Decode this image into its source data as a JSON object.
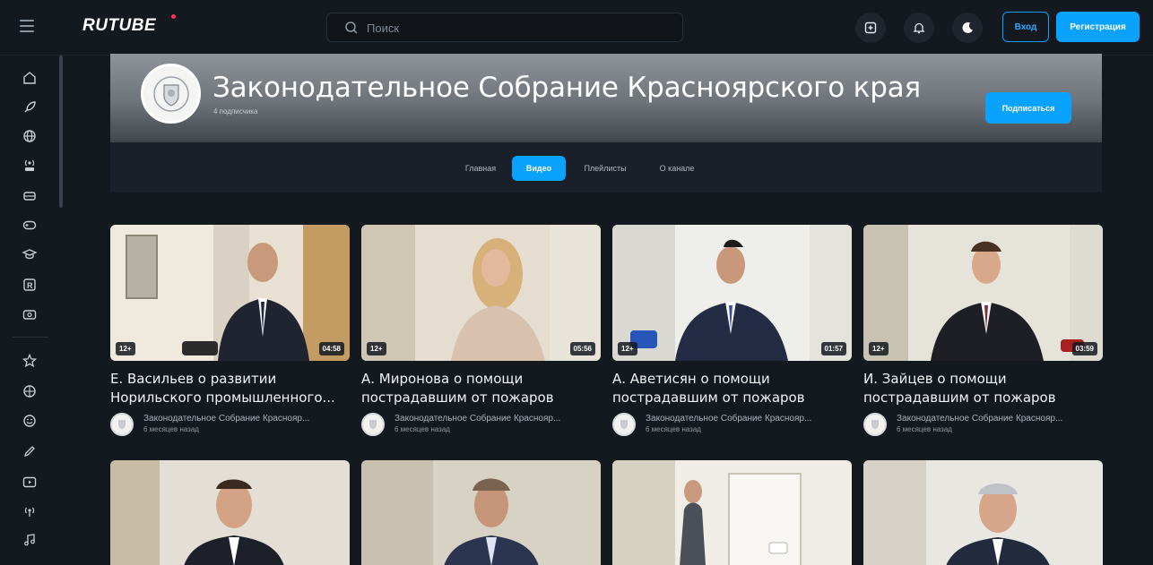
{
  "header": {
    "logo": "RUTUBE",
    "search_placeholder": "Поиск",
    "login_label": "Вход",
    "register_label": "Регистрация",
    "icons": [
      "upload-icon",
      "bell-icon",
      "moon-icon"
    ]
  },
  "sidebar": {
    "icons": [
      "home-icon",
      "rocket-icon",
      "globe-icon",
      "live-icon",
      "car-icon",
      "gamepad-icon",
      "graduation-cap-icon",
      "r-box-icon",
      "tv-icon",
      "star-icon",
      "basketball-icon",
      "smile-icon",
      "pen-icon",
      "tv-play-icon",
      "broadcast-icon",
      "music-icon"
    ]
  },
  "channel": {
    "title": "Законодательное Собрание Красноярского края",
    "subscribers": "4 подписчика",
    "subscribe_label": "Подписаться",
    "tabs": [
      {
        "label": "Главная"
      },
      {
        "label": "Видео"
      },
      {
        "label": "Плейлисты"
      },
      {
        "label": "О канале"
      }
    ],
    "active_tab": "Видео"
  },
  "videos": [
    {
      "title": "Е. Васильев о развитии Норильского промышленного...",
      "age": "12+",
      "duration": "04:58",
      "channel": "Законодательное Собрание Краснояр...",
      "date": "6 месяцев назад"
    },
    {
      "title": "А. Миронова о помощи пострадавшим от пожаров",
      "age": "12+",
      "duration": "05:56",
      "channel": "Законодательное Собрание Краснояр...",
      "date": "6 месяцев назад"
    },
    {
      "title": "А. Аветисян о помощи пострадавшим от пожаров",
      "age": "12+",
      "duration": "01:57",
      "channel": "Законодательное Собрание Краснояр...",
      "date": "6 месяцев назад"
    },
    {
      "title": "И. Зайцев о помощи пострадавшим от пожаров",
      "age": "12+",
      "duration": "03:59",
      "channel": "Законодательное Собрание Краснояр...",
      "date": "6 месяцев назад"
    }
  ],
  "colors": {
    "background": "#14191f",
    "accent": "#0aa2ff",
    "brand_dot": "#ff2d55"
  }
}
